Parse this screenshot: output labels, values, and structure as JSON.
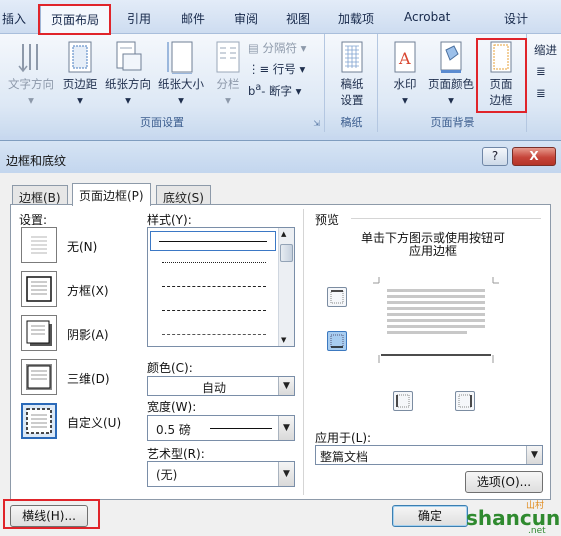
{
  "ribbon": {
    "tabs": [
      {
        "label": "插入"
      },
      {
        "label": "页面布局"
      },
      {
        "label": "引用"
      },
      {
        "label": "邮件"
      },
      {
        "label": "审阅"
      },
      {
        "label": "视图"
      },
      {
        "label": "加载项"
      },
      {
        "label": "Acrobat"
      },
      {
        "label": "设计"
      }
    ],
    "groups": {
      "page_setup": {
        "title": "页面设置",
        "text_direction": "文字方向",
        "margins": "页边距",
        "orientation": "纸张方向",
        "size": "纸张大小",
        "columns": "分栏",
        "breaks": "分隔符",
        "line_numbers": "行号",
        "hyphenation": "断字"
      },
      "draft": {
        "title": "稿纸",
        "draft_settings_line1": "稿纸",
        "draft_settings_line2": "设置"
      },
      "page_background": {
        "title": "页面背景",
        "watermark": "水印",
        "page_color": "页面颜色",
        "page_borders_line1": "页面",
        "page_borders_line2": "边框"
      },
      "paragraph": {
        "indent": "缩进"
      }
    }
  },
  "dialog": {
    "title": "边框和底纹",
    "help": "?",
    "close": "X",
    "tabs": [
      {
        "label": "边框(B)"
      },
      {
        "label": "页面边框(P)"
      },
      {
        "label": "底纹(S)"
      }
    ],
    "settings_label": "设置:",
    "settings": [
      {
        "label": "无(N)"
      },
      {
        "label": "方框(X)"
      },
      {
        "label": "阴影(A)"
      },
      {
        "label": "三维(D)"
      },
      {
        "label": "自定义(U)"
      }
    ],
    "style_label": "样式(Y):",
    "color_label": "颜色(C):",
    "color_value": "自动",
    "width_label": "宽度(W):",
    "width_value": "0.5 磅",
    "art_label": "艺术型(R):",
    "art_value": "(无)",
    "preview_label": "预览",
    "preview_hint_line1": "单击下方图示或使用按钮可",
    "preview_hint_line2": "应用边框",
    "apply_to_label": "应用于(L):",
    "apply_to_value": "整篇文档",
    "options_button": "选项(O)...",
    "horizontal_line_button": "横线(H)...",
    "ok_button": "确定"
  },
  "watermark": {
    "text1": "shancun",
    "text2": ".net",
    "text3": "山村"
  },
  "colors": {
    "highlight_box": "#e0242a",
    "selected_setting": "#2b6ab9",
    "close_button": "#c6453a"
  }
}
